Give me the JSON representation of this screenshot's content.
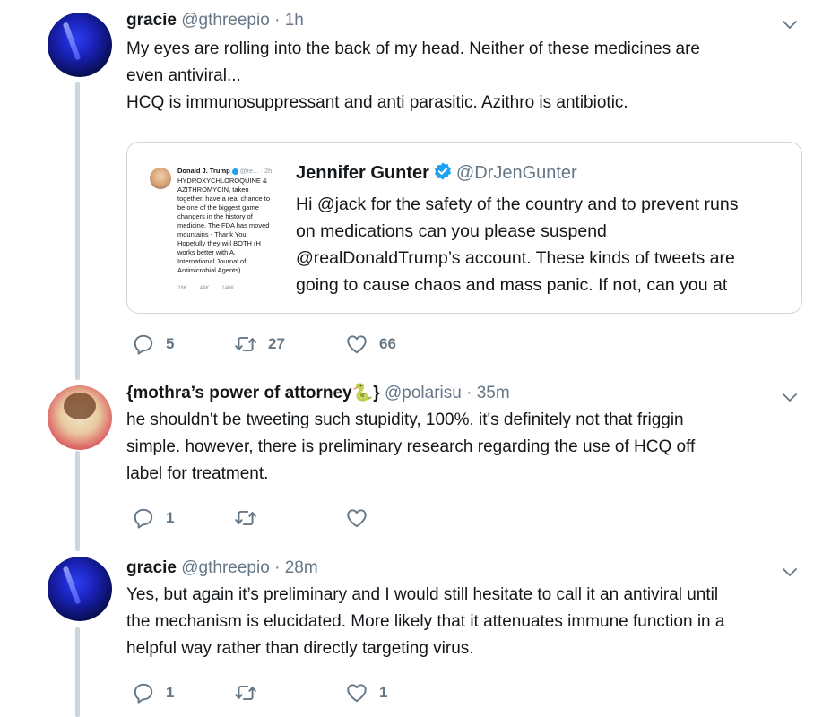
{
  "tweets": [
    {
      "name": "gracie",
      "handle": "@gthreepio",
      "sep": "·",
      "time": "1h",
      "lines": [
        "My eyes are rolling into the back of my head. Neither of these medicines are",
        "even antiviral...",
        "HCQ is immunosuppressant and anti parasitic. Azithro is antibiotic."
      ],
      "quote": {
        "name": "Jennifer Gunter",
        "handle": "@DrJenGunter",
        "lines": [
          "Hi @jack for the safety of the country and to prevent runs",
          "on medications can you please suspend",
          "@realDonaldTrump’s account. These kinds of tweets are",
          "going to cause chaos and mass panic. If not, can  you at"
        ],
        "thumb": {
          "name": "Donald J. Trump",
          "handle": "@re...",
          "time": "· 2h",
          "lines": [
            "HYDROXYCHLOROQUINE &",
            "AZITHROMYCIN, taken",
            "together, have a real chance to",
            "be one of the biggest game",
            "changers in the history of",
            "medicine. The FDA has moved",
            "mountains - Thank You!",
            "Hopefully they will BOTH (H",
            "works better with A,",
            "International Journal of",
            "Antimicrobial Agents)....."
          ],
          "replies": "28K",
          "retweets": "44K",
          "likes": "146K"
        }
      },
      "replies": "5",
      "retweets": "27",
      "likes": "66"
    },
    {
      "name": "{mothra’s power of attorney",
      "name_emoji": "🐍",
      "name_end": "}",
      "handle": "@polarisu",
      "sep": "·",
      "time": "35m",
      "lines": [
        "he shouldn't be tweeting such stupidity, 100%.  it's definitely not that friggin",
        "simple.  however, there is preliminary research regarding the use of HCQ off",
        "label for treatment."
      ],
      "replies": "1",
      "retweets": "",
      "likes": ""
    },
    {
      "name": "gracie",
      "handle": "@gthreepio",
      "sep": "·",
      "time": "28m",
      "lines": [
        "Yes, but again it’s preliminary and I would still hesitate to call it an antiviral until",
        "the mechanism is elucidated. More likely that it attenuates immune function in a",
        "helpful way rather than directly targeting virus."
      ],
      "replies": "1",
      "retweets": "",
      "likes": "1"
    }
  ],
  "colors": {
    "text": "#14171a",
    "secondary": "#657786",
    "border": "#ccd6dd",
    "verified": "#1da1f2",
    "emoji_green": "#3aa64a"
  },
  "icons": [
    "reply-icon",
    "retweet-icon",
    "like-icon",
    "chevron-down-icon",
    "verified-badge-icon"
  ]
}
